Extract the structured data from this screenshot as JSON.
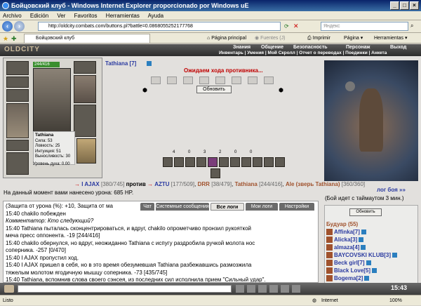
{
  "window": {
    "title": "Бойцовский клуб - Windows Internet Explorer proporcionado por Windows uE"
  },
  "menu": [
    "Archivo",
    "Edición",
    "Ver",
    "Favoritos",
    "Herramientas",
    "Ayuda"
  ],
  "address": {
    "url": "http://oldcity.combats.com/buttons.pl?battle=0.0868055252177768",
    "search_placeholder": "Яндекс"
  },
  "tab": {
    "label": "Бойцовский клуб"
  },
  "ie_toolbar": {
    "home": "Página principal",
    "feeds": "Fuentes (J)",
    "print": "Imprimir",
    "page": "Página",
    "tools": "Herramientas"
  },
  "game_menu": {
    "logo": "OLDCITY",
    "top": [
      "Знания",
      "Общение",
      "Безопасность",
      "Персонаж",
      "Выход"
    ],
    "sub": "Инвентарь | Умения | Мой Скролл | Отчет о переводах | Поединки | Анкета"
  },
  "player": {
    "hp": "244/416",
    "name": "Tathiana",
    "stats": [
      "Сила: 53",
      "Ловкость: 25",
      "Интуиция: 51",
      "Выносливость: 30"
    ],
    "spirit": "Уровень духа: 0.00"
  },
  "opponent": {
    "name": "Tathiana [7]",
    "waiting": "Ожидаем хода противника...",
    "refresh_label": "Обновить"
  },
  "counters": [
    "4",
    "0",
    "3",
    "2",
    "0",
    "0"
  ],
  "battle": {
    "left_name": "I AJAX",
    "left_hp": "[380/745]",
    "vs": "против",
    "enemies": [
      {
        "name": "AZTU",
        "hp": "[177/509]"
      },
      {
        "name": "DRR",
        "hp": "[38/479]"
      },
      {
        "name": "Tathiana",
        "hp": "[244/416]"
      },
      {
        "name": "Ale (зверь Tathiana)",
        "hp": "[360/360]"
      }
    ],
    "damage_line": "На данный момент вами нанесено урона: 685 HP.",
    "log_link": "лог боя »»",
    "timeout": "(Бой идет с таймаутом 3 мин.)"
  },
  "chat": {
    "tabs": [
      "Чат",
      "Системные сообщения",
      "Все логи",
      "Мои логи",
      "Настройки"
    ],
    "active_tab": "Все логи",
    "lines": [
      "(Защита от урона (%): +10, Защита от ма",
      "15:40 chakilo побежден",
      "Комментатор: Кто следующий?",
      "15:40 Tathiana пыталась сконцентрироваться, и вдруг, chakilo опрометчиво пронзил рукояткой",
      "меча пресс оппонента. -19 [244/416]",
      "15:40 chakilo обернулся, но вдруг, неожиданно Tathiana с испугу раздробила ручкой молота нос",
      "соперника. -257 [0/470]",
      "15:40 I AJAX пропустил ход.",
      "15:40 I AJAX пришел в себя, но в это время обезумевшая Tathiana разбежавшись размозжила",
      "тяжелым молотом ягодичную мышцу соперника. -73 [435/745]",
      "15:40 Tathiana, вспомнив слова своего сэнсея, из последних сил исполнила прием \"Сильный удар\"."
    ]
  },
  "room": {
    "refresh": "Обновить",
    "title": "Будуар (55)",
    "players": [
      "Affinka[7]",
      "Alicka[3]",
      "almaza[4]",
      "BAYCOVSKI KLUB[3]",
      "Beck girl[7]",
      "Black Love[5]",
      "Bogema[2]"
    ]
  },
  "status": {
    "left": "Listo",
    "zone": "Internet",
    "zoom": "100%",
    "clock": "15:43"
  }
}
